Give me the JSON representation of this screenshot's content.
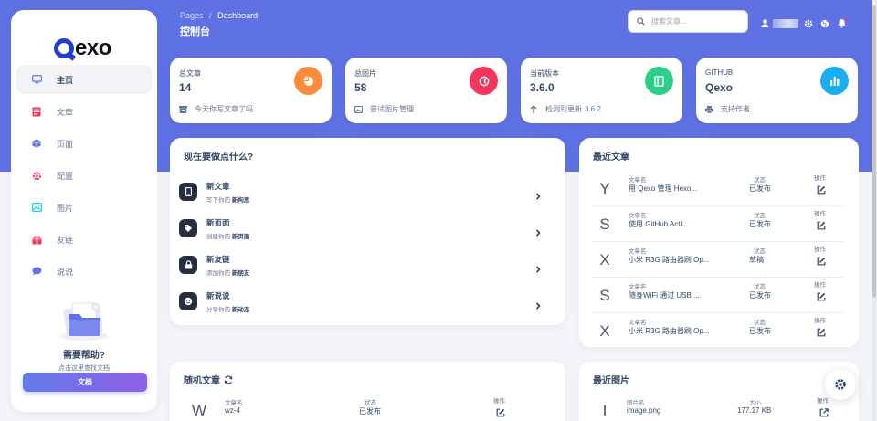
{
  "app": {
    "logo_text": "exo",
    "brand_color": "#5e72e4"
  },
  "sidebar": {
    "items": [
      {
        "label": "主页",
        "icon": "monitor-icon",
        "color": "#5e72e4"
      },
      {
        "label": "文章",
        "icon": "book-icon",
        "color": "#f5365c"
      },
      {
        "label": "页面",
        "icon": "cube-icon",
        "color": "#5e72e4"
      },
      {
        "label": "配置",
        "icon": "gear-icon",
        "color": "#f5365c"
      },
      {
        "label": "图片",
        "icon": "image-icon",
        "color": "#11cdef"
      },
      {
        "label": "友链",
        "icon": "gift-icon",
        "color": "#f5365c"
      },
      {
        "label": "说说",
        "icon": "chat-icon",
        "color": "#5e72e4"
      }
    ],
    "help_title": "需要帮助?",
    "help_subtitle": "点击这里查找文档",
    "doc_button": "文档"
  },
  "header": {
    "breadcrumb_root": "Pages",
    "breadcrumb_sep": "/",
    "breadcrumb_current": "Dashboard",
    "title": "控制台",
    "search_placeholder": "搜索文章..."
  },
  "stats": [
    {
      "label": "总文章",
      "value": "14",
      "footer": "今天你写文章了吗",
      "footer_highlight": "",
      "icon": "pie-chart-icon",
      "color": "#fb8c3c",
      "footer_icon": "box-icon"
    },
    {
      "label": "总图片",
      "value": "58",
      "footer": "尝试图片管理",
      "footer_highlight": "",
      "icon": "image-icon",
      "color": "#f5365c",
      "footer_icon": "image-icon"
    },
    {
      "label": "当前版本",
      "value": "3.6.0",
      "footer": "检测到更新",
      "footer_highlight": "3.6.2",
      "icon": "book-icon",
      "color": "#2dce89",
      "footer_icon": "arrow-up-icon"
    },
    {
      "label": "GITHUB",
      "value": "Qexo",
      "footer": "支持作者",
      "footer_highlight": "",
      "icon": "bar-chart-icon",
      "color": "#1aaef0",
      "footer_icon": "print-icon"
    }
  ],
  "todo": {
    "title": "现在要做点什么?",
    "items": [
      {
        "title": "新文章",
        "sub_prefix": "写下你的",
        "sub_bold": "新构思",
        "icon": "phone-icon"
      },
      {
        "title": "新页面",
        "sub_prefix": "创建你的",
        "sub_bold": "新页面",
        "icon": "tag-icon"
      },
      {
        "title": "新友链",
        "sub_prefix": "添加你的",
        "sub_bold": "新朋友",
        "icon": "lock-icon"
      },
      {
        "title": "新说说",
        "sub_prefix": "分享你的",
        "sub_bold": "新动态",
        "icon": "smile-icon"
      }
    ]
  },
  "recent_posts": {
    "title": "最近文章",
    "col_name": "文章名",
    "col_status": "状态",
    "col_action": "操作",
    "rows": [
      {
        "letter": "Y",
        "name": "用 Qexo 管理 Hexo...",
        "status": "已发布"
      },
      {
        "letter": "S",
        "name": "使用 GitHub Acti...",
        "status": "已发布"
      },
      {
        "letter": "X",
        "name": "小米 R3G 路由器刷 Op...",
        "status": "草稿"
      },
      {
        "letter": "S",
        "name": "随身WiFi 通过 USB ...",
        "status": "已发布"
      },
      {
        "letter": "X",
        "name": "小米 R3G 路由器刷 Op...",
        "status": "已发布"
      }
    ]
  },
  "random_posts": {
    "title": "随机文章",
    "col_name": "文章名",
    "col_status": "状态",
    "col_action": "操作",
    "rows": [
      {
        "letter": "W",
        "name": "wz-4",
        "status": "已发布"
      }
    ]
  },
  "recent_images": {
    "title": "最近图片",
    "col_name": "图片名",
    "col_size": "大小",
    "col_action": "操作",
    "rows": [
      {
        "letter": "I",
        "name": "image.png",
        "size": "177.17 KB"
      }
    ]
  }
}
